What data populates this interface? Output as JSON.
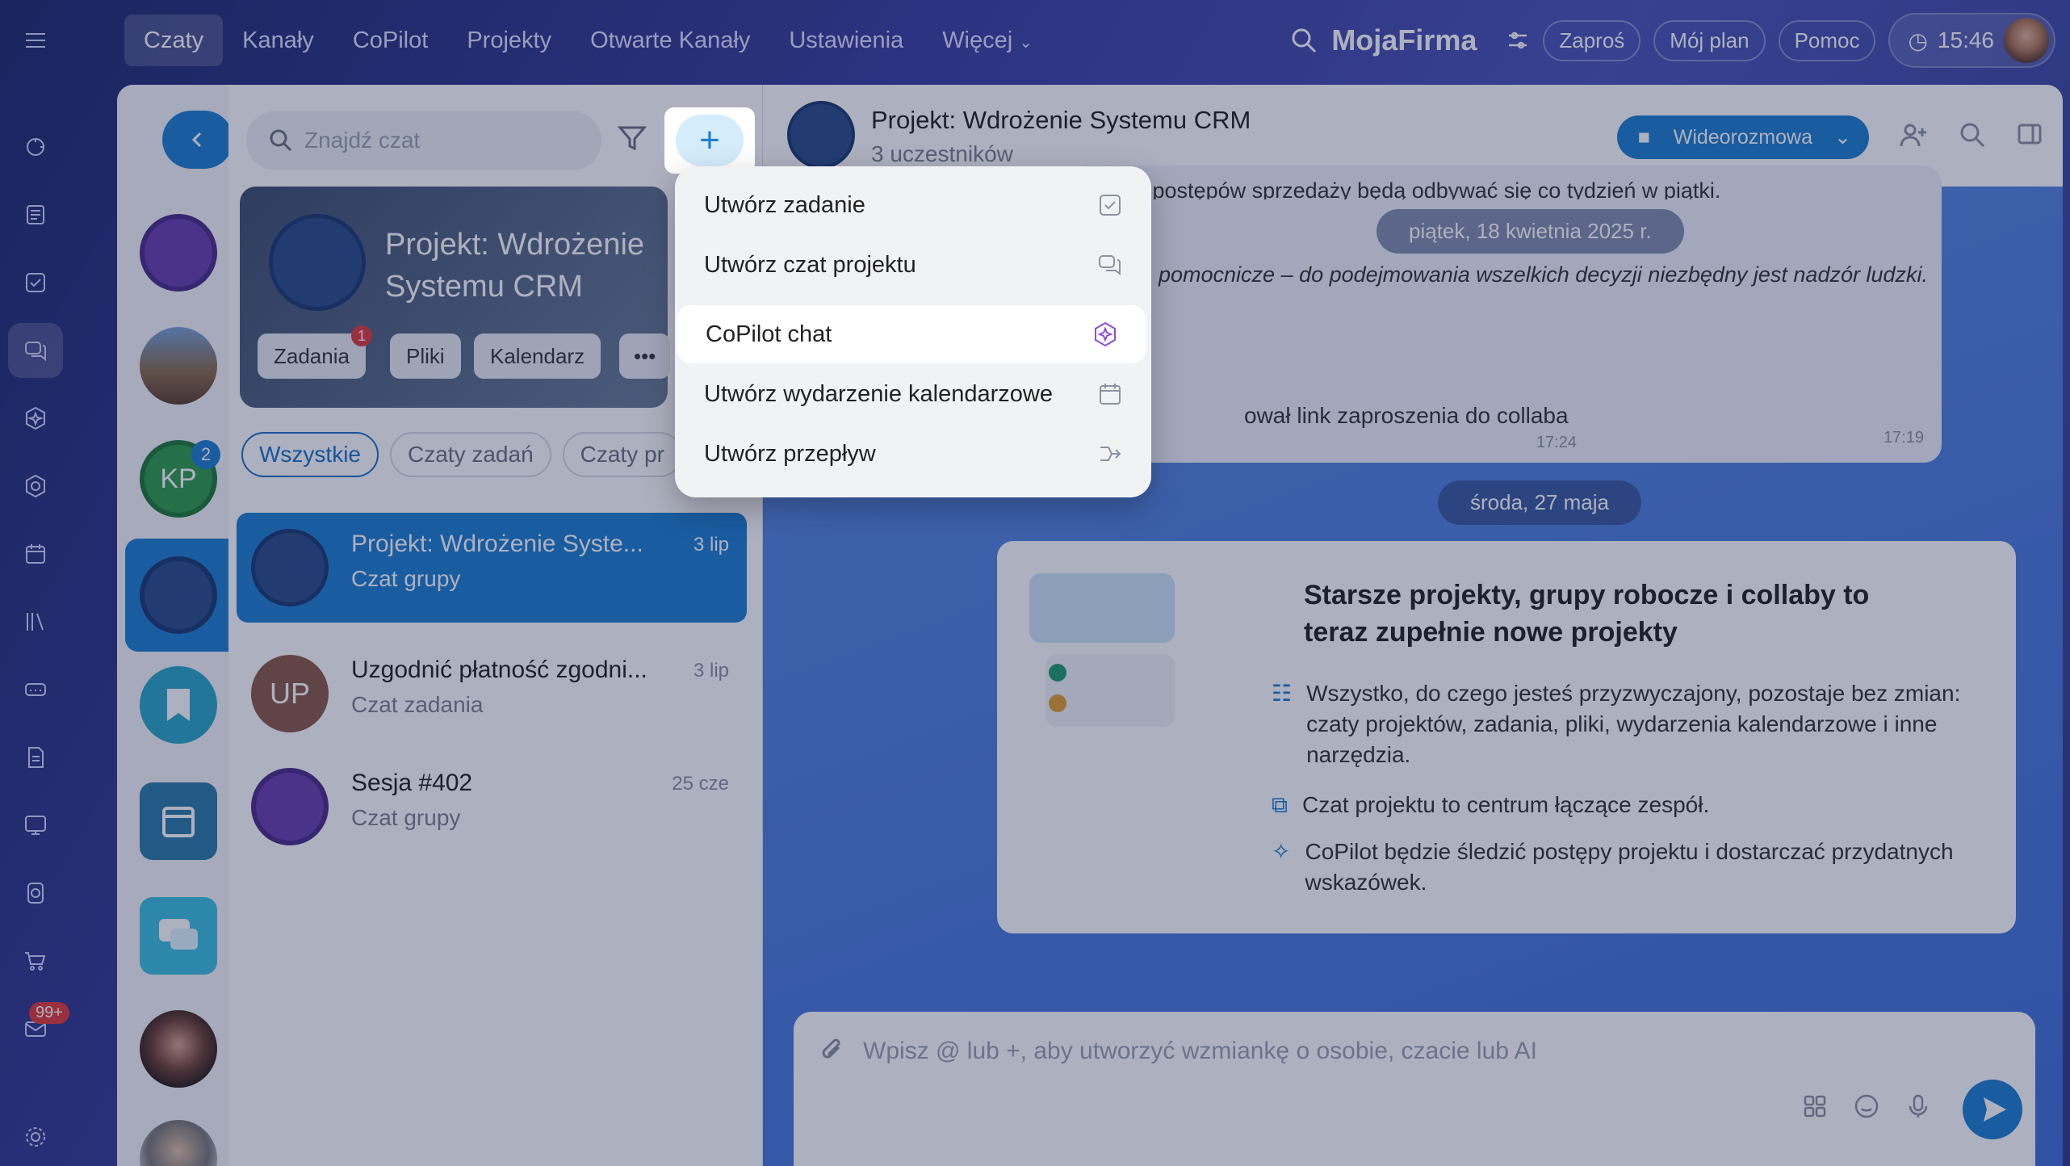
{
  "nav": {
    "items": [
      "Czaty",
      "Kanały",
      "CoPilot",
      "Projekty",
      "Otwarte Kanały",
      "Ustawienia",
      "Więcej"
    ],
    "active": "Czaty"
  },
  "topright": {
    "brand": "MojaFirma",
    "invite": "Zaproś",
    "plan": "Mój plan",
    "help": "Pomoc",
    "time": "15:46"
  },
  "rail": {
    "mail_badge": "99+"
  },
  "recents": {
    "kp_initials": "KP",
    "kp_badge": "2"
  },
  "list": {
    "search_placeholder": "Znajdź czat",
    "project_card": {
      "title": "Projekt: Wdrożenie Systemu CRM",
      "chips": [
        "Zadania",
        "Pliki",
        "Kalendarz"
      ],
      "tasks_badge": "1"
    },
    "tabs": [
      "Wszystkie",
      "Czaty zadań",
      "Czaty pr"
    ],
    "chats": [
      {
        "title": "Projekt: Wdrożenie Syste...",
        "sub": "Czat grupy",
        "date": "3 lip"
      },
      {
        "title": "Uzgodnić płatność zgodni...",
        "sub": "Czat zadania",
        "date": "3 lip",
        "initials": "UP"
      },
      {
        "title": "Sesja #402",
        "sub": "Czat grupy",
        "date": "25 cze"
      }
    ]
  },
  "chat": {
    "title": "Projekt: Wdrożenie Systemu CRM",
    "participants": "3 uczestników",
    "video_label": "Wideorozmowa",
    "msg_top": "o postępów sprzedaży będą odbywać się co tydzień w piątki.",
    "date1": "piątek, 18 kwietnia 2025 r.",
    "msg_italic": "pomocnicze – do podejmowania wszelkich decyzji niezbędny jest nadzór ludzki.",
    "time1": "17:19",
    "msg_link": "ował link zaproszenia do collaba",
    "time2": "17:24",
    "date2": "środa, 27 maja",
    "card_title": "Starsze projekty, grupy robocze i collaby to teraz zupełnie nowe projekty",
    "card_rows": [
      "Wszystko, do czego jesteś przyzwyczajony, pozostaje bez zmian: czaty projektów, zadania, pliki, wydarzenia kalendarzowe i inne narzędzia.",
      "Czat projektu to centrum łączące zespół.",
      "CoPilot będzie śledzić postępy projektu i dostarczać przydatnych wskazówek."
    ],
    "composer_placeholder": "Wpisz @ lub +, aby utworzyć wzmiankę o osobie, czacie lub AI"
  },
  "menu": {
    "items": [
      {
        "label": "Utwórz zadanie",
        "icon": "task-check-icon"
      },
      {
        "label": "Utwórz czat projektu",
        "icon": "chat-bubbles-icon"
      },
      {
        "label": "CoPilot chat",
        "icon": "copilot-icon"
      },
      {
        "label": "Utwórz wydarzenie kalendarzowe",
        "icon": "calendar-icon"
      },
      {
        "label": "Utwórz przepływ",
        "icon": "flow-icon"
      }
    ],
    "highlighted": "CoPilot chat"
  },
  "colors": {
    "accent": "#1d7fd1",
    "badge": "#e23b3b"
  }
}
